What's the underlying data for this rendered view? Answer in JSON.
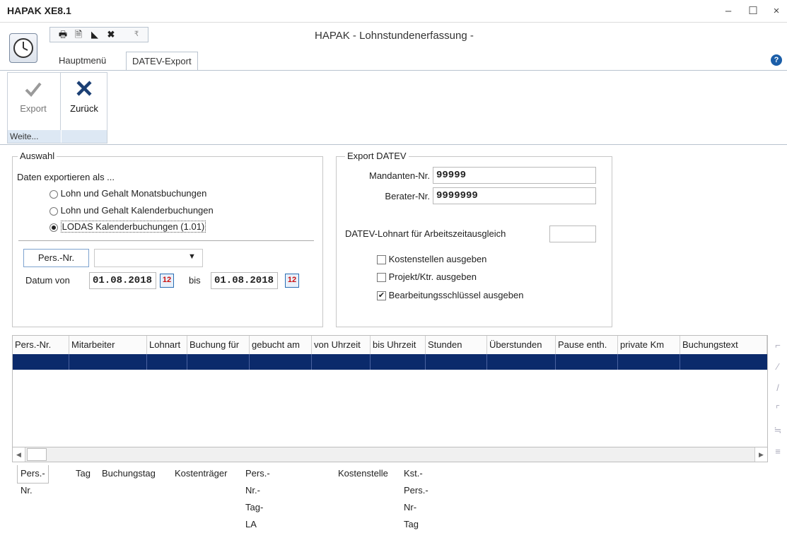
{
  "app": {
    "title": "HAPAK XE8.1",
    "caption": "HAPAK - Lohnstundenerfassung -"
  },
  "window_controls": {
    "minimize": "–",
    "maximize": "☐",
    "close": "×"
  },
  "qat": {
    "print": "🖶",
    "doc": "🗎",
    "triangle": "◣",
    "close": "✖",
    "dropdown": "₹"
  },
  "tabs": [
    {
      "label": "Hauptmenü"
    },
    {
      "label": "DATEV-Export"
    }
  ],
  "help": "?",
  "ribbon": {
    "export_label": "Export",
    "back_label": "Zurück",
    "group_caption": "Weite..."
  },
  "auswahl": {
    "title": "Auswahl",
    "intro": "Daten exportieren als ...",
    "options": [
      {
        "label": "Lohn und Gehalt Monatsbuchungen",
        "selected": false
      },
      {
        "label": "Lohn und Gehalt Kalenderbuchungen",
        "selected": false
      },
      {
        "label": "LODAS Kalenderbuchungen (1.01)",
        "selected": true
      }
    ],
    "pers_button": "Pers.-Nr.",
    "pers_value": "",
    "datum_von_label": "Datum von",
    "datum_von": "01.08.2018",
    "bis_label": "bis",
    "datum_bis": "01.08.2018"
  },
  "export": {
    "title": "Export DATEV",
    "mandant_label": "Mandanten-Nr.",
    "mandant_value": "99999",
    "berater_label": "Berater-Nr.",
    "berater_value": "9999999",
    "lohnart_label": "DATEV-Lohnart für Arbeitszeitausgleich",
    "lohnart_value": "",
    "checks": [
      {
        "label": "Kostenstellen ausgeben",
        "checked": false
      },
      {
        "label": "Projekt/Ktr. ausgeben",
        "checked": false
      },
      {
        "label": "Bearbeitungsschlüssel ausgeben",
        "checked": true
      }
    ]
  },
  "grid": {
    "columns": [
      "Pers.-Nr.",
      "Mitarbeiter",
      "Lohnart",
      "Buchung für",
      "gebucht am",
      "von Uhrzeit",
      "bis Uhrzeit",
      "Stunden",
      "Überstunden",
      "Pause enth.",
      "private Km",
      "Buchungstext"
    ],
    "selected_row_color": "#0b2a6b"
  },
  "bottom_tabs": [
    "Pers.-Nr.",
    "Tag",
    "Buchungstag",
    "Kostenträger",
    "Pers.-Nr.-Tag-LA",
    "Kostenstelle",
    "Kst.-Pers.-Nr-Tag"
  ]
}
